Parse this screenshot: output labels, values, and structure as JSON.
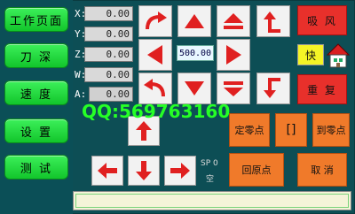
{
  "sidebar": {
    "items": [
      {
        "label": "工作页面"
      },
      {
        "label": "刀 深"
      },
      {
        "label": "速 度"
      },
      {
        "label": "设 置"
      },
      {
        "label": "测 试"
      }
    ]
  },
  "coords": [
    {
      "axis": "X:",
      "value": "0.00"
    },
    {
      "axis": "Y:",
      "value": "0.00"
    },
    {
      "axis": "Z:",
      "value": "0.00"
    },
    {
      "axis": "W:",
      "value": "0.00"
    },
    {
      "axis": "A:",
      "value": "0.00"
    }
  ],
  "speed": "500.00",
  "buttons": {
    "suction": "吸 风",
    "fast": "快",
    "repeat": "重 复",
    "set_zero": "定零点",
    "bracket": "[]",
    "goto_zero": "到零点",
    "return_origin": "回原点",
    "cancel": "取 消"
  },
  "status": {
    "sp_label": "SP 0",
    "sp_sub": "空"
  },
  "watermark": "QQ:569763160",
  "colors": {
    "background": "#0d4e55",
    "side_button": "#22d93a",
    "red_button": "#e8302b",
    "orange_button": "#f07a2a",
    "yellow_button": "#f4f426",
    "arrow_red": "#e02020"
  }
}
